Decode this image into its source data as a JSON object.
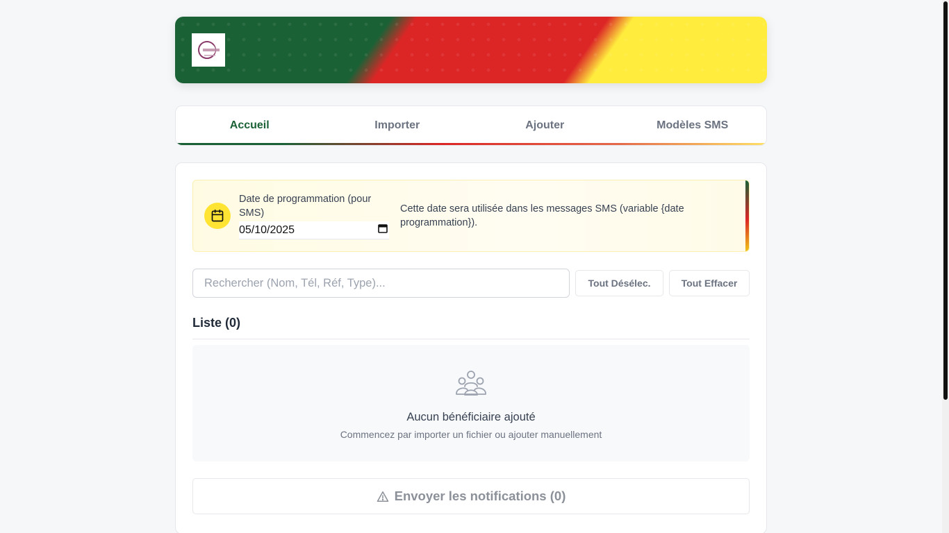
{
  "tabs": [
    {
      "label": "Accueil"
    },
    {
      "label": "Importer"
    },
    {
      "label": "Ajouter"
    },
    {
      "label": "Modèles SMS"
    }
  ],
  "active_tab": "Accueil",
  "schedule": {
    "label": "Date de programmation (pour SMS)",
    "date_value": "05/10/2025",
    "description": "Cette date sera utilisée dans les messages SMS (variable {date programmation})."
  },
  "search": {
    "placeholder": "Rechercher (Nom, Tél, Réf, Type)..."
  },
  "actions": {
    "deselect_all": "Tout Désélec.",
    "clear_all": "Tout Effacer"
  },
  "list": {
    "title": "Liste (0)",
    "empty_title": "Aucun bénéficiaire ajouté",
    "empty_subtitle": "Commencez par importer un fichier ou ajouter manuellement"
  },
  "send": {
    "label": "Envoyer les notifications (0)"
  },
  "colors": {
    "green": "#1b6136",
    "red": "#dc2626",
    "yellow": "#ffec3d"
  },
  "icons": [
    "calendar-icon",
    "users-icon",
    "warning-icon",
    "logo"
  ]
}
